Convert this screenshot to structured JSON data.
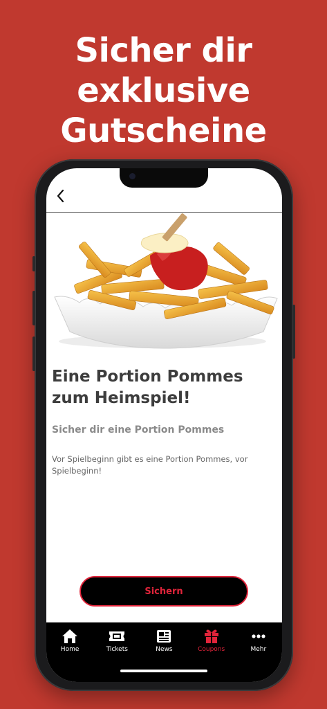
{
  "headline": {
    "line1": "Sicher dir",
    "line2": "exklusive",
    "line3": "Gutscheine"
  },
  "offer": {
    "title": "Eine Portion Pommes zum Heimspiel!",
    "subtitle": "Sicher dir eine Portion Pommes",
    "description": "Vor Spielbeginn gibt es eine Portion Pommes, vor Spielbeginn!",
    "cta_label": "Sichern"
  },
  "tabbar": {
    "items": [
      {
        "label": "Home",
        "icon": "home-icon",
        "active": false
      },
      {
        "label": "Tickets",
        "icon": "ticket-icon",
        "active": false
      },
      {
        "label": "News",
        "icon": "newspaper-icon",
        "active": false
      },
      {
        "label": "Coupons",
        "icon": "gift-icon",
        "active": true
      },
      {
        "label": "Mehr",
        "icon": "more-icon",
        "active": false
      }
    ]
  },
  "colors": {
    "background": "#c0392f",
    "accent": "#e0243a",
    "tabbar": "#000000"
  }
}
